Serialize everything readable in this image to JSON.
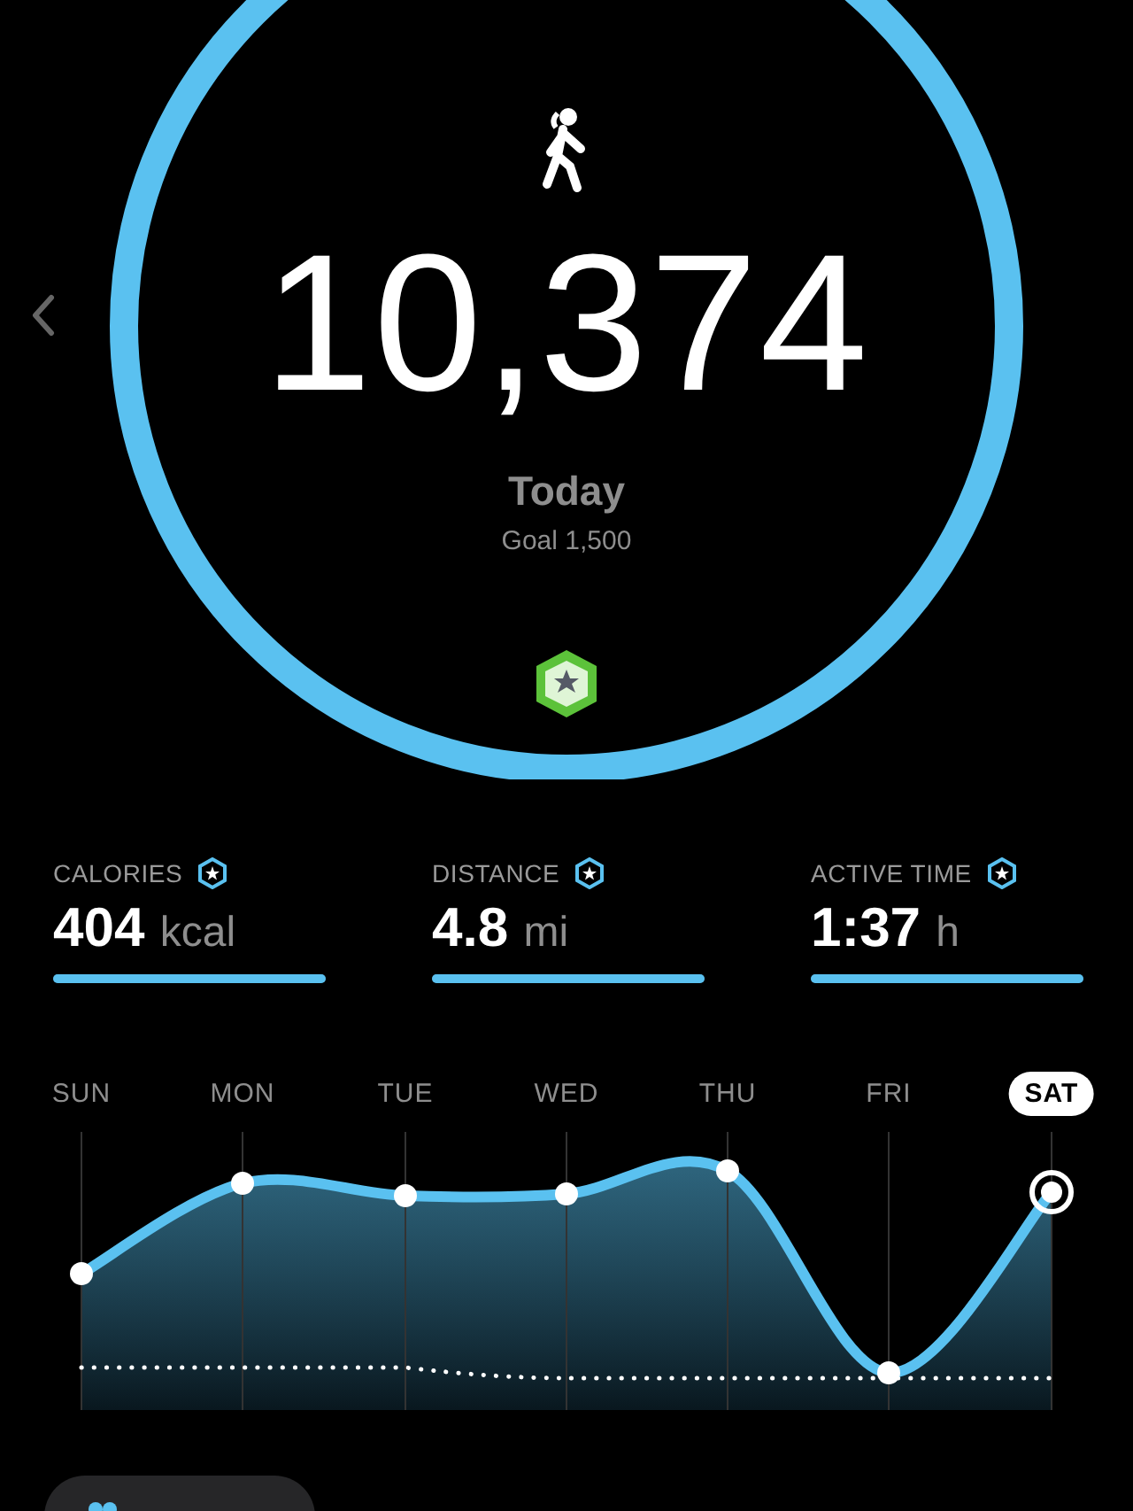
{
  "steps": {
    "count": "10,374",
    "period": "Today",
    "goal": "Goal 1,500"
  },
  "metrics": [
    {
      "label": "CALORIES",
      "value": "404",
      "unit": "kcal",
      "level": 1
    },
    {
      "label": "DISTANCE",
      "value": "4.8",
      "unit": "mi",
      "level": 1
    },
    {
      "label": "ACTIVE TIME",
      "value": "1:37",
      "unit": "h",
      "level": 1
    }
  ],
  "days": [
    {
      "label": "SUN",
      "selected": false
    },
    {
      "label": "MON",
      "selected": false
    },
    {
      "label": "TUE",
      "selected": false
    },
    {
      "label": "WED",
      "selected": false
    },
    {
      "label": "THU",
      "selected": false
    },
    {
      "label": "FRI",
      "selected": false
    },
    {
      "label": "SAT",
      "selected": true
    }
  ]
}
